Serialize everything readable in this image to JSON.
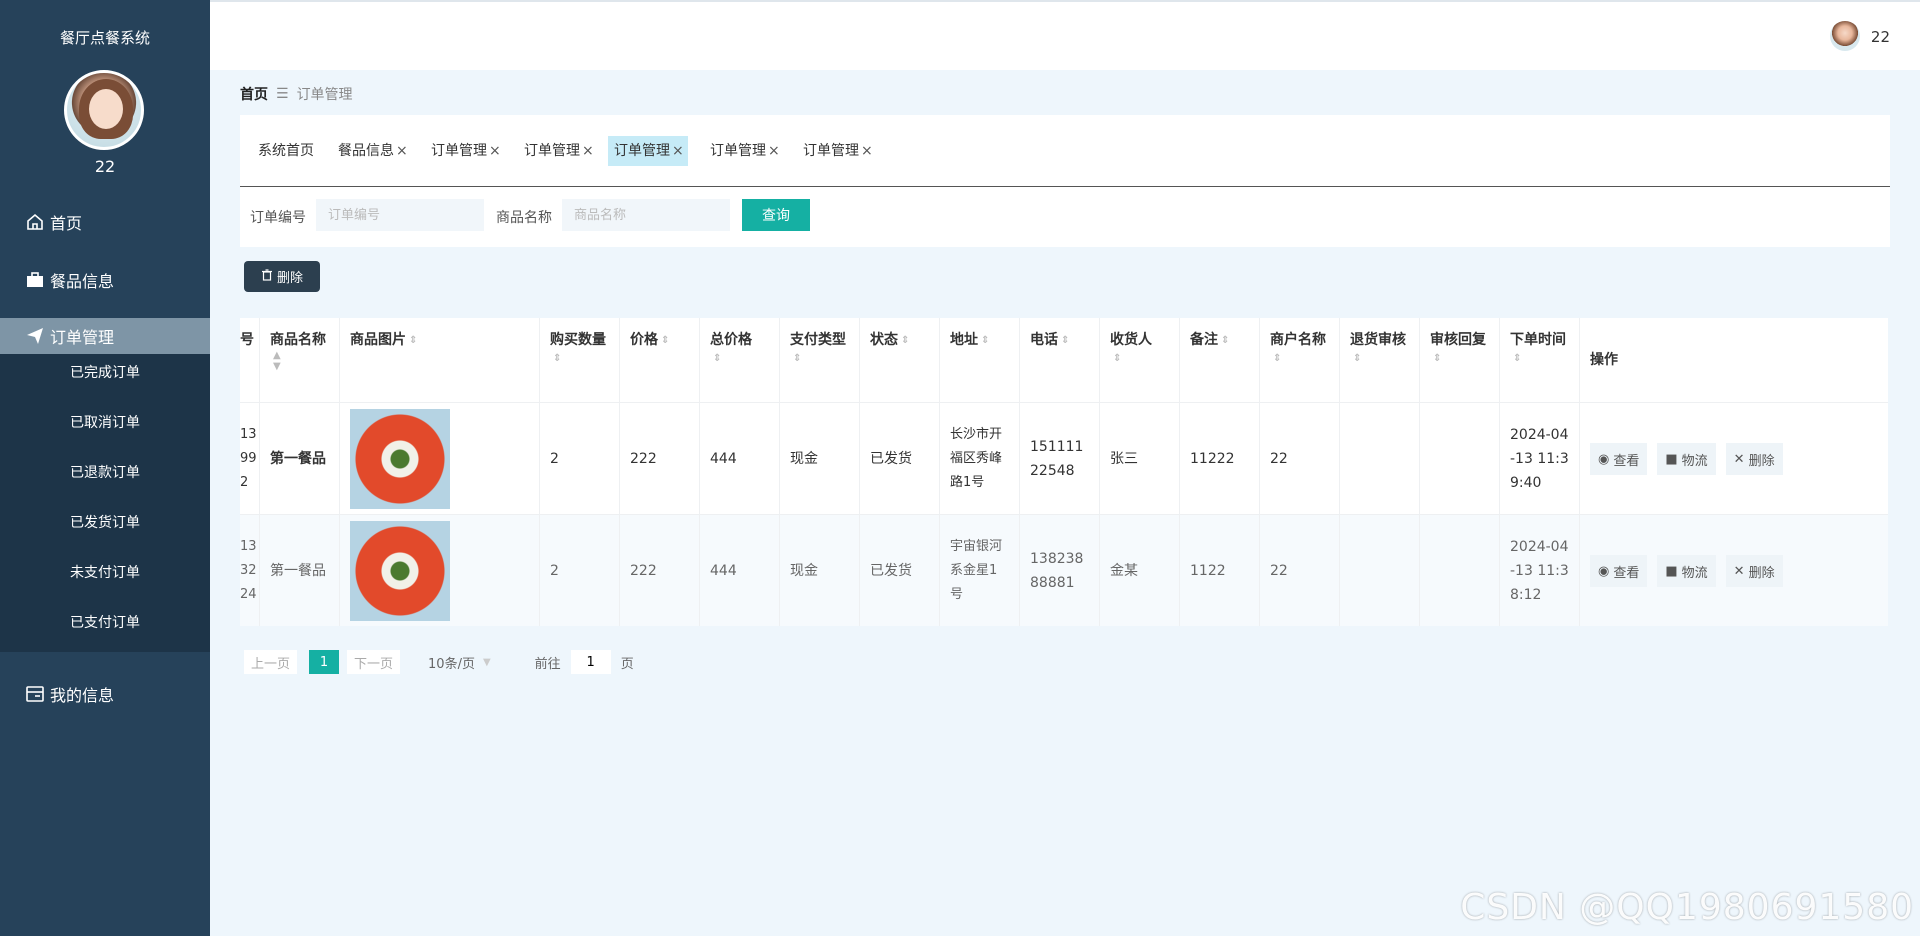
{
  "sidebar": {
    "system_title": "餐厅点餐系统",
    "username": "22",
    "nav": {
      "home": "首页",
      "food": "餐品信息",
      "orders": "订单管理",
      "my_info": "我的信息"
    },
    "sub_items": [
      "已完成订单",
      "已取消订单",
      "已退款订单",
      "已发货订单",
      "未支付订单",
      "已支付订单"
    ]
  },
  "topbar": {
    "username": "22"
  },
  "breadcrumb": {
    "home": "首页",
    "separator": "☰",
    "current": "订单管理"
  },
  "tabs": [
    {
      "label": "系统首页",
      "closable": false
    },
    {
      "label": "餐品信息",
      "closable": true
    },
    {
      "label": "订单管理",
      "closable": true
    },
    {
      "label": "订单管理",
      "closable": true
    },
    {
      "label": "订单管理",
      "closable": true,
      "active": true
    },
    {
      "label": "订单管理",
      "closable": true
    },
    {
      "label": "订单管理",
      "closable": true
    }
  ],
  "tab_close_glyph": "×",
  "search": {
    "order_no_label": "订单编号",
    "order_no_placeholder": "订单编号",
    "product_label": "商品名称",
    "product_placeholder": "商品名称",
    "query_button": "查询"
  },
  "toolbar": {
    "delete_label": "删除"
  },
  "table": {
    "headers": [
      "号",
      "商品名称",
      "商品图片",
      "购买数量",
      "价格",
      "总价格",
      "支付类型",
      "状态",
      "地址",
      "电话",
      "收货人",
      "备注",
      "商户名称",
      "退货审核",
      "审核回复",
      "下单时间",
      "操作"
    ],
    "rows": [
      {
        "no": "13\n99\n2",
        "product": "第一餐品",
        "qty": "2",
        "price": "222",
        "total": "444",
        "pay_type": "现金",
        "status": "已发货",
        "address": "长沙市开福区秀峰路1号",
        "phone": "15111122548",
        "receiver": "张三",
        "remark": "11222",
        "merchant": "22",
        "return_review": "",
        "review_reply": "",
        "order_time": "2024-04-13 11:39:40"
      },
      {
        "no": "13\n32\n24",
        "product": "第一餐品",
        "qty": "2",
        "price": "222",
        "total": "444",
        "pay_type": "现金",
        "status": "已发货",
        "address": "宇宙银河系金星1号",
        "phone": "13823888881",
        "receiver": "金某",
        "remark": "1122",
        "merchant": "22",
        "return_review": "",
        "review_reply": "",
        "order_time": "2024-04-13 11:38:12"
      }
    ],
    "actions": {
      "view": "查看",
      "logistics": "物流",
      "delete": "删除"
    }
  },
  "pagination": {
    "prev": "上一页",
    "current_page": "1",
    "next": "下一页",
    "page_size": "10条/页",
    "goto_label": "前往",
    "goto_value": "1",
    "page_unit": "页"
  },
  "watermark": "CSDN @QQ1980691580",
  "colors": {
    "sidebar_bg": "#26425a",
    "accent": "#15b0a3",
    "active_tab": "#c6ebf7"
  }
}
